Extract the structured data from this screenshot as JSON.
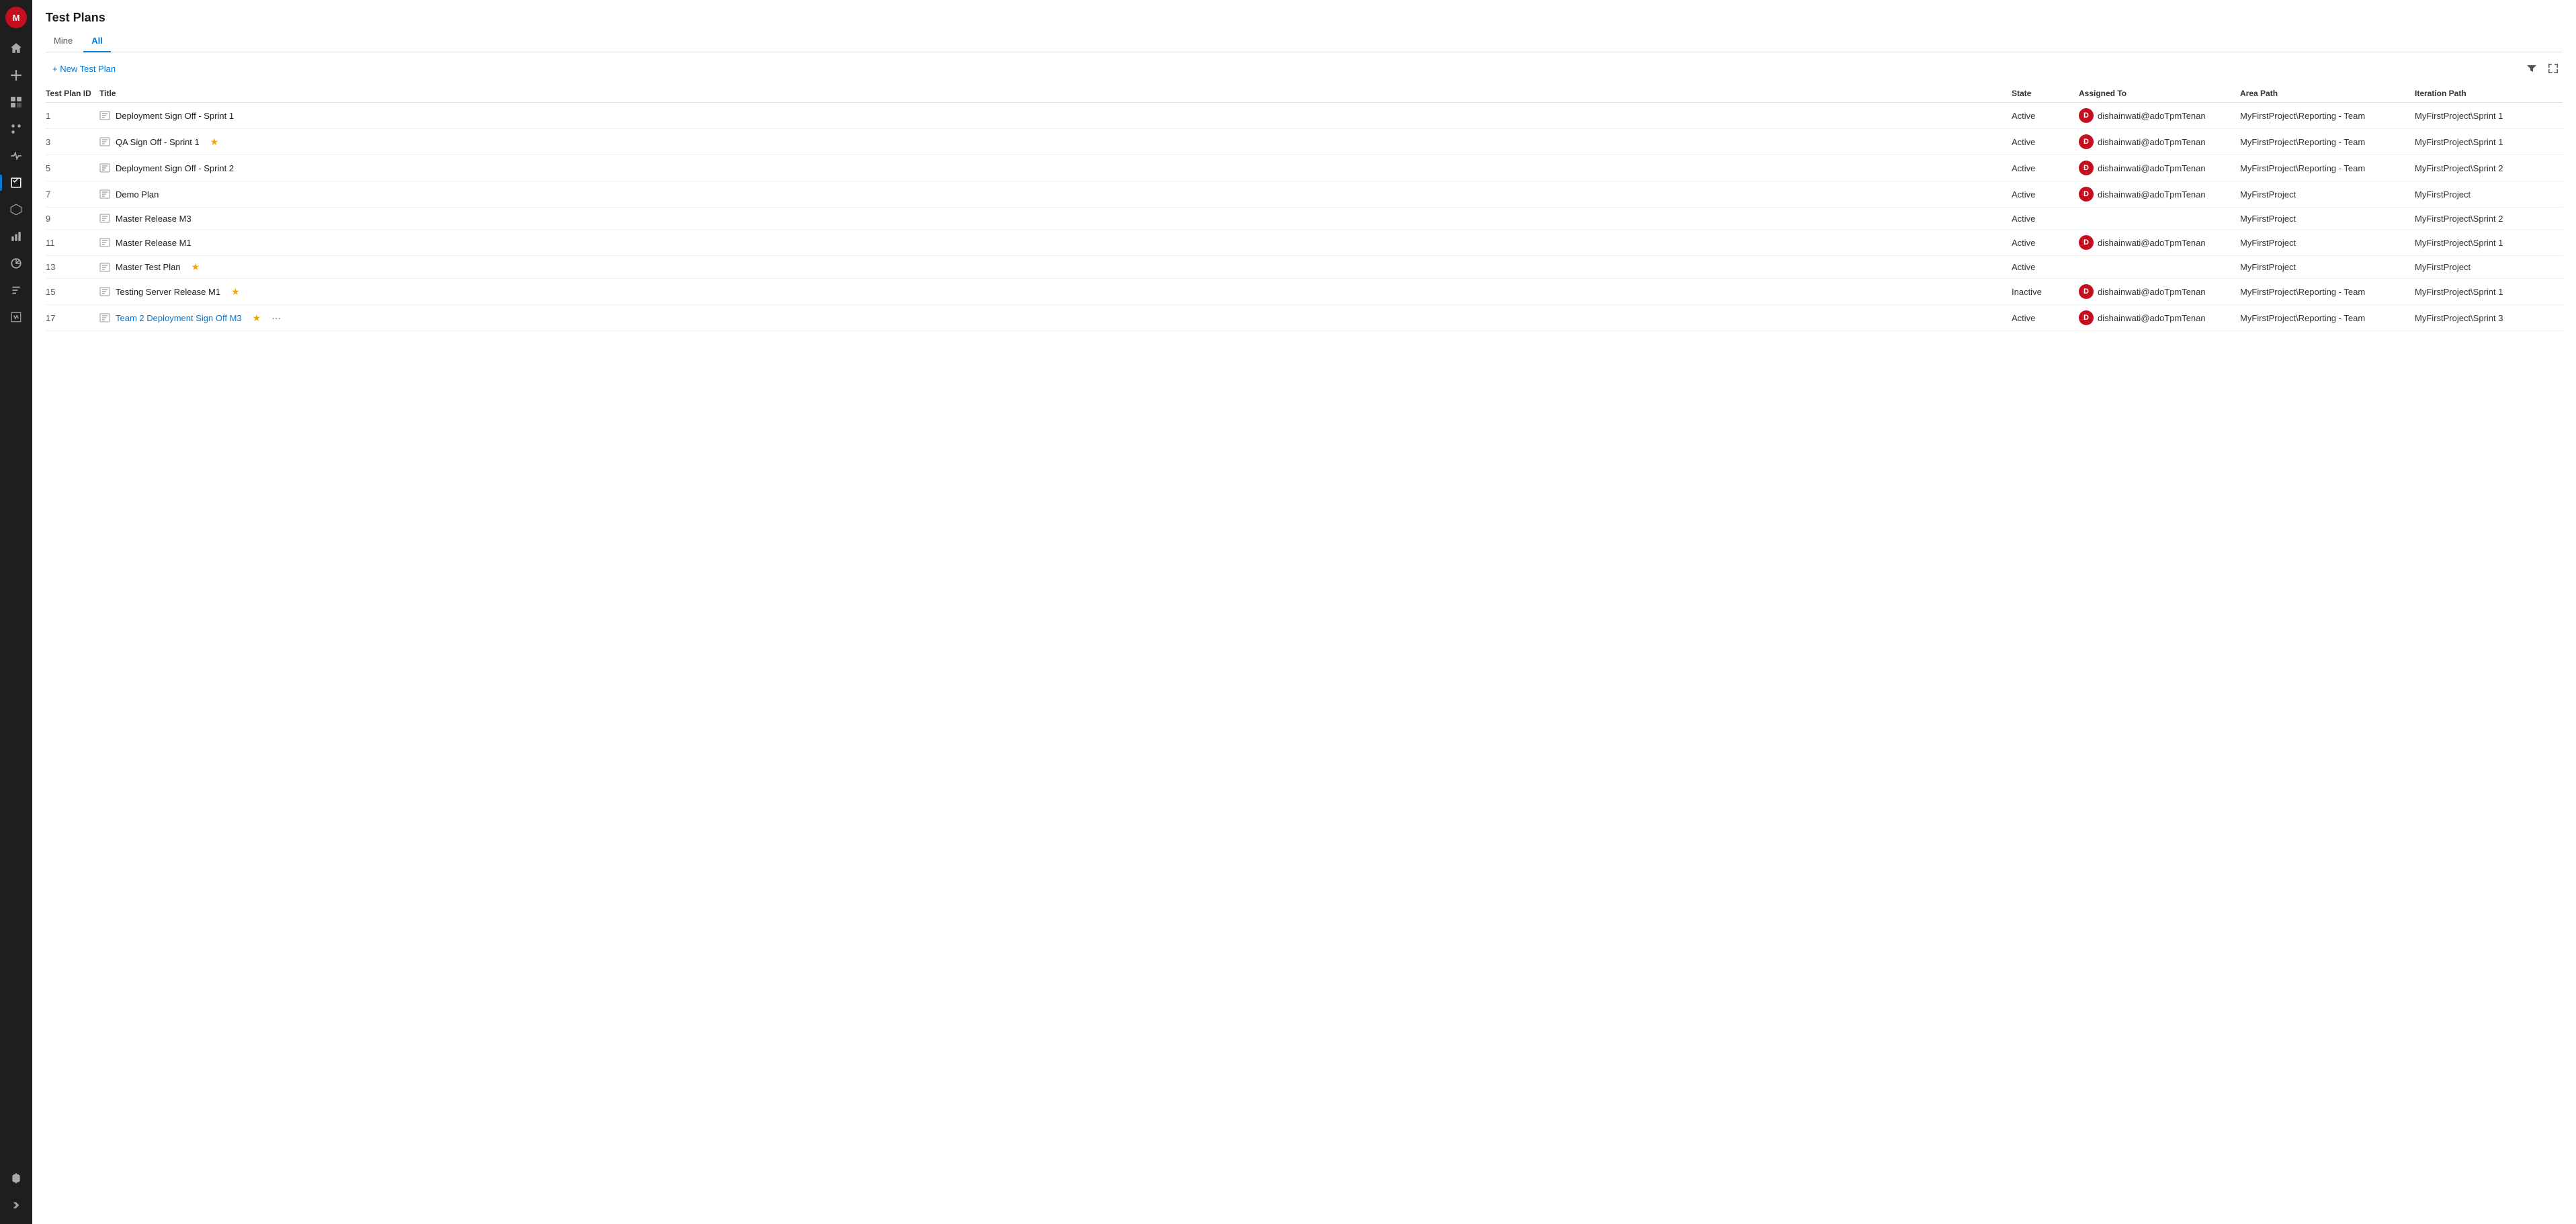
{
  "page": {
    "title": "Test Plans"
  },
  "nav": {
    "avatar_initial": "M",
    "items": [
      {
        "name": "home-icon",
        "label": "Home"
      },
      {
        "name": "add-icon",
        "label": "New"
      },
      {
        "name": "boards-icon",
        "label": "Boards"
      },
      {
        "name": "repos-icon",
        "label": "Repos"
      },
      {
        "name": "pipelines-icon",
        "label": "Pipelines"
      },
      {
        "name": "testplans-icon",
        "label": "Test Plans"
      },
      {
        "name": "artifacts-icon",
        "label": "Artifacts"
      },
      {
        "name": "reports-icon",
        "label": "Reports"
      },
      {
        "name": "analytics-icon",
        "label": "Analytics"
      },
      {
        "name": "requests-icon",
        "label": "Requests"
      },
      {
        "name": "wiki-icon",
        "label": "Wiki"
      }
    ],
    "bottom": [
      {
        "name": "settings-icon",
        "label": "Settings"
      },
      {
        "name": "expand-icon",
        "label": "Expand"
      }
    ]
  },
  "tabs": [
    {
      "id": "mine",
      "label": "Mine"
    },
    {
      "id": "all",
      "label": "All",
      "active": true
    }
  ],
  "toolbar": {
    "new_plan_label": "+ New Test Plan",
    "filter_icon": "filter",
    "fullscreen_icon": "fullscreen"
  },
  "table": {
    "columns": [
      {
        "id": "id",
        "label": "Test Plan ID"
      },
      {
        "id": "title",
        "label": "Title"
      },
      {
        "id": "state",
        "label": "State"
      },
      {
        "id": "assigned",
        "label": "Assigned To"
      },
      {
        "id": "area",
        "label": "Area Path"
      },
      {
        "id": "iteration",
        "label": "Iteration Path"
      }
    ],
    "rows": [
      {
        "id": "1",
        "title": "Deployment Sign Off - Sprint 1",
        "isLink": false,
        "starred": false,
        "more": false,
        "state": "Active",
        "assigned": "dishainwati@adoTpmTenan",
        "hasAvatar": true,
        "area": "MyFirstProject\\Reporting - Team",
        "iteration": "MyFirstProject\\Sprint 1"
      },
      {
        "id": "3",
        "title": "QA Sign Off - Sprint 1",
        "isLink": false,
        "starred": true,
        "more": false,
        "state": "Active",
        "assigned": "dishainwati@adoTpmTenan",
        "hasAvatar": true,
        "area": "MyFirstProject\\Reporting - Team",
        "iteration": "MyFirstProject\\Sprint 1"
      },
      {
        "id": "5",
        "title": "Deployment Sign Off - Sprint 2",
        "isLink": false,
        "starred": false,
        "more": false,
        "state": "Active",
        "assigned": "dishainwati@adoTpmTenan",
        "hasAvatar": true,
        "area": "MyFirstProject\\Reporting - Team",
        "iteration": "MyFirstProject\\Sprint 2"
      },
      {
        "id": "7",
        "title": "Demo Plan",
        "isLink": false,
        "starred": false,
        "more": false,
        "state": "Active",
        "assigned": "dishainwati@adoTpmTenan",
        "hasAvatar": true,
        "area": "MyFirstProject",
        "iteration": "MyFirstProject"
      },
      {
        "id": "9",
        "title": "Master Release M3",
        "isLink": false,
        "starred": false,
        "more": false,
        "state": "Active",
        "assigned": "",
        "hasAvatar": false,
        "area": "MyFirstProject",
        "iteration": "MyFirstProject\\Sprint 2"
      },
      {
        "id": "11",
        "title": "Master Release M1",
        "isLink": false,
        "starred": false,
        "more": false,
        "state": "Active",
        "assigned": "dishainwati@adoTpmTenan",
        "hasAvatar": true,
        "area": "MyFirstProject",
        "iteration": "MyFirstProject\\Sprint 1"
      },
      {
        "id": "13",
        "title": "Master Test Plan",
        "isLink": false,
        "starred": true,
        "more": false,
        "state": "Active",
        "assigned": "",
        "hasAvatar": false,
        "area": "MyFirstProject",
        "iteration": "MyFirstProject"
      },
      {
        "id": "15",
        "title": "Testing Server Release M1",
        "isLink": false,
        "starred": true,
        "more": false,
        "state": "Inactive",
        "assigned": "dishainwati@adoTpmTenan",
        "hasAvatar": true,
        "area": "MyFirstProject\\Reporting - Team",
        "iteration": "MyFirstProject\\Sprint 1"
      },
      {
        "id": "17",
        "title": "Team 2 Deployment Sign Off M3",
        "isLink": true,
        "starred": true,
        "more": true,
        "state": "Active",
        "assigned": "dishainwati@adoTpmTenan",
        "hasAvatar": true,
        "area": "MyFirstProject\\Reporting - Team",
        "iteration": "MyFirstProject\\Sprint 3"
      }
    ]
  }
}
